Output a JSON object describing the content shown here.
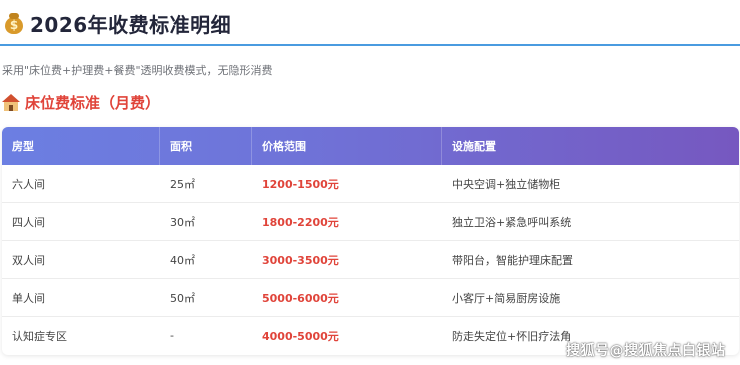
{
  "page": {
    "title_icon": "money-bag-icon",
    "title": "2026年收费标准明细",
    "intro": "采用\"床位费+护理费+餐费\"透明收费模式，无隐形消费"
  },
  "section": {
    "icon": "house-icon",
    "title": "床位费标准（月费）"
  },
  "table": {
    "headers": [
      "房型",
      "面积",
      "价格范围",
      "设施配置"
    ],
    "rows": [
      [
        "六人间",
        "25㎡",
        "1200-1500元",
        "中央空调+独立储物柜"
      ],
      [
        "四人间",
        "30㎡",
        "1800-2200元",
        "独立卫浴+紧急呼叫系统"
      ],
      [
        "双人间",
        "40㎡",
        "3000-3500元",
        "带阳台，智能护理床配置"
      ],
      [
        "单人间",
        "50㎡",
        "5000-6000元",
        "小客厅+简易厨房设施"
      ],
      [
        "认知症专区",
        "-",
        "4000-5000元",
        "防走失定位+怀旧疗法角"
      ]
    ]
  },
  "watermark": "搜狐号@搜狐焦点白银站",
  "colors": {
    "accent_red": "#e0443a",
    "header_gradient_start": "#6c7fe2",
    "header_gradient_end": "#7658c0",
    "rule_blue": "#4a9be0"
  }
}
